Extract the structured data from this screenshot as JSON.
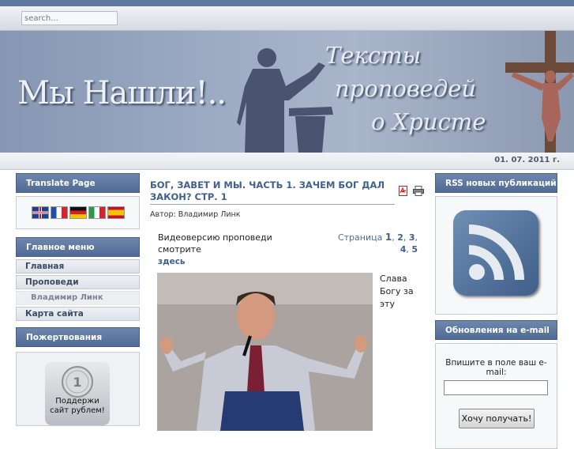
{
  "search": {
    "placeholder": "search..."
  },
  "banner": {
    "title": "Мы Нашли!..",
    "subtitle_line1": "Тексты",
    "subtitle_line2": "проповедей",
    "subtitle_line3": "о Христе"
  },
  "date": "01. 07. 2011 г.",
  "left": {
    "translate": {
      "heading": "Translate Page",
      "flags": [
        "english-flag",
        "french-flag",
        "german-flag",
        "italian-flag",
        "spanish-flag"
      ]
    },
    "main_menu": {
      "heading": "Главное меню",
      "items": [
        "Главная",
        "Проповеди",
        "Владимир Линк",
        "Карта сайта"
      ]
    },
    "donations": {
      "heading": "Пожертвования",
      "caption_line1": "Поддержи",
      "caption_line2": "сайт рублем!"
    }
  },
  "article": {
    "title": "БОГ, ЗАВЕТ И МЫ. ЧАСТЬ 1. ЗАЧЕМ БОГ ДАЛ ЗАКОН? СТР. 1",
    "author": "Автор: Владимир Линк",
    "video_text": "Видеоверсию проповеди смотрите",
    "video_link": "здесь",
    "pages_label": "Страница",
    "pages": [
      "1",
      "2",
      "3",
      "4",
      "5"
    ],
    "side_text": "Слава Богу за эту"
  },
  "right": {
    "rss": {
      "heading": "RSS новых публикаций"
    },
    "email": {
      "heading": "Обновления на e-mail",
      "label": "Впишите в поле ваш e-mail:",
      "button": "Хочу получать!"
    }
  }
}
